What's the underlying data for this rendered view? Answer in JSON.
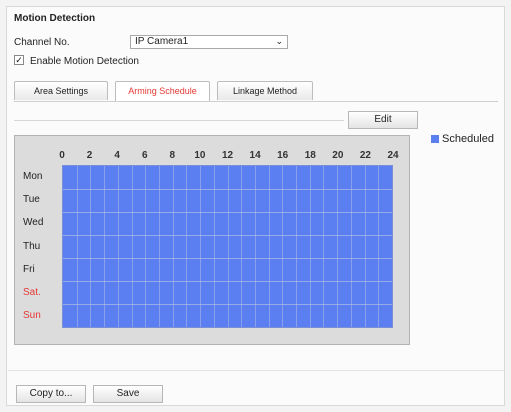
{
  "section_title": "Motion Detection",
  "channel": {
    "label": "Channel No.",
    "value": "IP Camera1"
  },
  "enable": {
    "label": "Enable Motion Detection",
    "checked": true
  },
  "tabs": [
    {
      "label": "Area Settings",
      "active": false
    },
    {
      "label": "Arming Schedule",
      "active": true
    },
    {
      "label": "Linkage Method",
      "active": false
    }
  ],
  "edit_label": "Edit",
  "legend": {
    "label": "Scheduled",
    "color": "#5b7ef0"
  },
  "schedule": {
    "hours": [
      "0",
      "2",
      "4",
      "6",
      "8",
      "10",
      "12",
      "14",
      "16",
      "18",
      "20",
      "22",
      "24"
    ],
    "days": [
      "Mon",
      "Tue",
      "Wed",
      "Thu",
      "Fri",
      "Sat.",
      "Sun"
    ],
    "weekend_days": [
      "Sat.",
      "Sun"
    ],
    "all_scheduled": true
  },
  "buttons": {
    "copy_to": "Copy to...",
    "save": "Save"
  }
}
